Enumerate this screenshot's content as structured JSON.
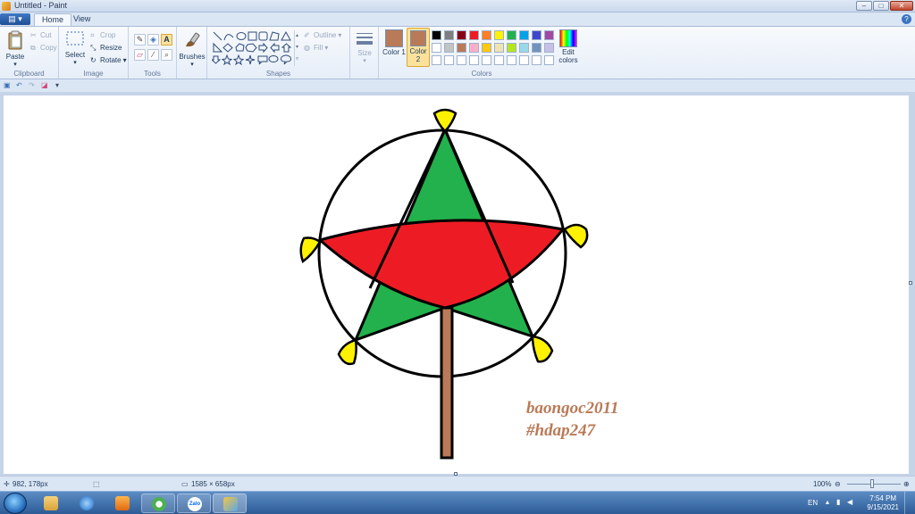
{
  "titlebar": {
    "title": "Untitled - Paint",
    "minimize": "–",
    "maximize": "□",
    "close": "✕"
  },
  "tabs": {
    "menu": "▤ ▾",
    "home": "Home",
    "view": "View",
    "help": "?"
  },
  "ribbon": {
    "clipboard": {
      "label": "Clipboard",
      "paste": "Paste",
      "cut": "Cut",
      "copy": "Copy"
    },
    "image": {
      "label": "Image",
      "select": "Select",
      "crop": "Crop",
      "resize": "Resize",
      "rotate": "Rotate"
    },
    "tools": {
      "label": "Tools"
    },
    "brushes": {
      "label": "Brushes"
    },
    "shapes": {
      "label": "Shapes",
      "outline": "Outline",
      "fill": "Fill"
    },
    "size": {
      "label": "Size"
    },
    "colors": {
      "label": "Colors",
      "color1": "Color 1",
      "color2": "Color 2",
      "edit_colors": "Edit colors",
      "color1_value": "#b97a57",
      "color2_value": "#b97a57",
      "row1": [
        "#000000",
        "#7f7f7f",
        "#880015",
        "#ed1c24",
        "#ff7f27",
        "#fff200",
        "#22b14c",
        "#00a2e8",
        "#3f48cc",
        "#a349a4"
      ],
      "row2": [
        "#ffffff",
        "#c3c3c3",
        "#b97a57",
        "#ffaec9",
        "#ffc90e",
        "#efe4b0",
        "#b5e61d",
        "#99d9ea",
        "#7092be",
        "#c8bfe7"
      ]
    }
  },
  "drawing": {
    "text_line1": "baongoc2011",
    "text_line2": "#hdap247",
    "circle_color": "#000000",
    "star_green": "#22b14c",
    "star_red": "#ed1c24",
    "tips_yellow": "#fff200",
    "stick_brown": "#b97a57"
  },
  "statusbar": {
    "cursor": "982, 178px",
    "canvas_size": "1585 × 658px",
    "zoom": "100%"
  },
  "taskbar": {
    "lang": "EN",
    "time": "7:54 PM",
    "date": "9/15/2021",
    "zalo": "Zalo"
  }
}
